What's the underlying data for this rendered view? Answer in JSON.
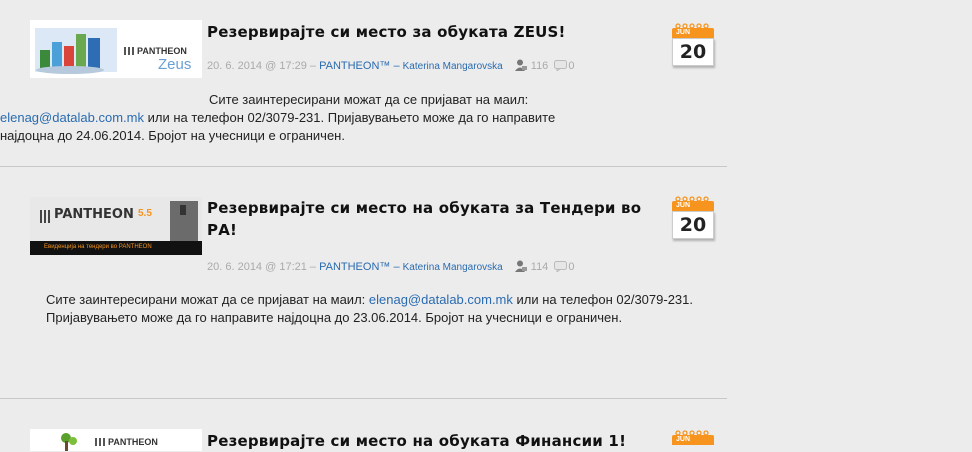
{
  "posts": [
    {
      "title": "Резервирајте си место за обуката ZEUS!",
      "date": "20. 6. 2014 @ 17:29 – ",
      "category": "PANTHEON™",
      "sep": " – ",
      "author": "Katerina Mangarovska",
      "views": "116",
      "comments": "0",
      "cal_month": "JUN",
      "cal_day": "20",
      "thumb_brand": "PANTHEON",
      "thumb_sub": "Zeus",
      "body_line1": "Сите заинтересирани можат да се пријават на маил:",
      "body_email": "elenag@datalab.com.mk",
      "body_line2": " или на телефон 02/3079-231. Пријавувањето може да го направите",
      "body_line3": "најдоцна до  24.06.2014. Бројот на учесници е ограничен."
    },
    {
      "title": "Резервирајте си место на обуката за Тендери во РА!",
      "date": "20. 6. 2014 @ 17:21 – ",
      "category": "PANTHEON™",
      "sep": " – ",
      "author": "Katerina Mangarovska",
      "views": "114",
      "comments": "0",
      "cal_month": "JUN",
      "cal_day": "20",
      "thumb_brand": "PANTHEON",
      "thumb_version": "5.5",
      "thumb_tagline": "Евиденција на тендери во PANTHEON",
      "body_pre": "Сите заинтересирани можат да се пријават на маил: ",
      "body_email": "elenag@datalab.com.mk",
      "body_post": " или на телефон 02/3079-231. Пријавувањето може да го направите најдоцна до  23.06.2014. Бројот на учесници е ограничен."
    },
    {
      "title": "Резервирајте си место на обуката Финансии 1!",
      "cal_month": "JUN",
      "thumb_brand": "PANTHEON"
    }
  ]
}
